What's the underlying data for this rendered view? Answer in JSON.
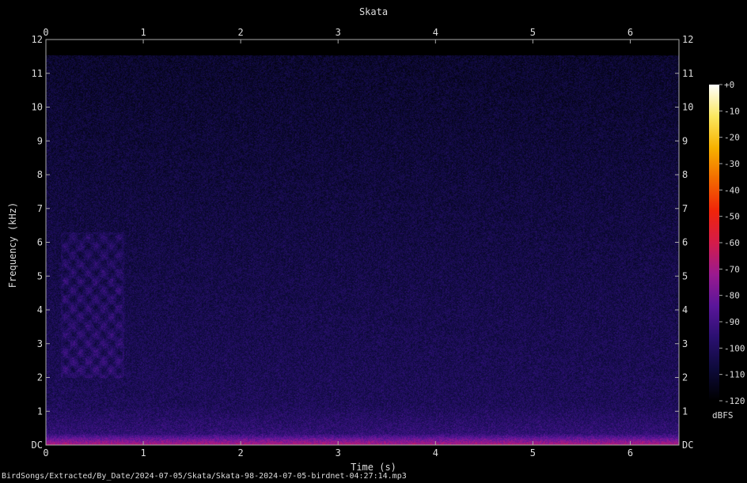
{
  "chart_data": {
    "type": "heatmap",
    "title": "Skata",
    "xlabel": "Time (s)",
    "ylabel": "Frequency (kHz)",
    "xlim": [
      0,
      6.5
    ],
    "ylim": [
      0,
      12
    ],
    "x_ticks": [
      "0",
      "1",
      "2",
      "3",
      "4",
      "5",
      "6"
    ],
    "x_tick_values": [
      0,
      1,
      2,
      3,
      4,
      5,
      6
    ],
    "y_ticks": [
      "DC",
      "1",
      "2",
      "3",
      "4",
      "5",
      "6",
      "7",
      "8",
      "9",
      "10",
      "11",
      "12"
    ],
    "y_tick_values": [
      0,
      1,
      2,
      3,
      4,
      5,
      6,
      7,
      8,
      9,
      10,
      11,
      12
    ],
    "colorbar": {
      "unit": "dBFS",
      "range": [
        -120,
        0
      ],
      "ticks": [
        "+0",
        "-10",
        "-20",
        "-30",
        "-40",
        "-50",
        "-60",
        "-70",
        "-80",
        "-90",
        "-100",
        "-110",
        "-120"
      ],
      "tick_values": [
        0,
        -10,
        -20,
        -30,
        -40,
        -50,
        -60,
        -70,
        -80,
        -90,
        -100,
        -110,
        -120
      ],
      "colormap": [
        "#000000",
        "#0d0a3a",
        "#2a1070",
        "#5a169a",
        "#9a1a8f",
        "#d41c4a",
        "#f0240a",
        "#f26a00",
        "#f7b200",
        "#fbe860",
        "#ffffff"
      ]
    },
    "grid": true,
    "legend": "colorbar-right"
  },
  "footer": "BirdSongs/Extracted/By_Date/2024-07-05/Skata/Skata-98-2024-07-05-birdnet-04:27:14.mp3"
}
